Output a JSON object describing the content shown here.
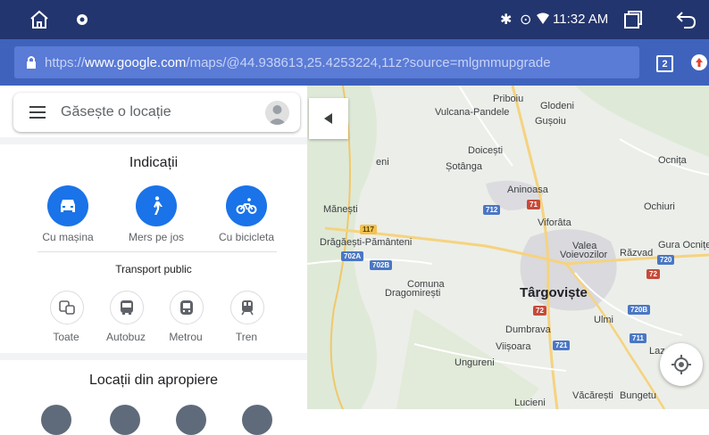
{
  "status_bar": {
    "time": "11:32 AM",
    "icons": [
      "home-icon",
      "settings-icon",
      "bluetooth-icon",
      "location-icon",
      "wifi-icon",
      "recents-icon",
      "back-icon"
    ]
  },
  "browser": {
    "url_prefix": "https://",
    "url_host": "www.google.com",
    "url_path": "/maps/@44.938613,25.4253224,11z?source=mlgmmupgrade",
    "tab_count": "2"
  },
  "sidebar": {
    "search_placeholder": "Găsește o locație",
    "directions_title": "Indicații",
    "directions": [
      {
        "label": "Cu mașina",
        "icon": "car-icon"
      },
      {
        "label": "Mers pe jos",
        "icon": "walk-icon"
      },
      {
        "label": "Cu bicicleta",
        "icon": "bike-icon"
      }
    ],
    "transit_title": "Transport public",
    "transit": [
      {
        "label": "Toate",
        "icon": "all-transit-icon"
      },
      {
        "label": "Autobuz",
        "icon": "bus-icon"
      },
      {
        "label": "Metrou",
        "icon": "subway-icon"
      },
      {
        "label": "Tren",
        "icon": "train-icon"
      }
    ],
    "nearby_title": "Locații din apropiere"
  },
  "map": {
    "places": [
      "Priboiu",
      "Glodeni",
      "Vulcana-Pandele",
      "Gușoiu",
      "Doicești",
      "Șotânga",
      "Ocnița",
      "eni",
      "Aninoasa",
      "Mănești",
      "Viforâta",
      "Ochiuri",
      "Drăgăești-Pământeni",
      "Valea",
      "Voievozilor",
      "Răzvad",
      "Gura Ocniței",
      "Comuna",
      "Dragomirești",
      "Târgoviște",
      "Ulmi",
      "Dumbrava",
      "Viișoara",
      "Ungureni",
      "Laz",
      "Văcărești",
      "Bungetu",
      "Lucieni"
    ],
    "road_shields": [
      "712",
      "71",
      "117",
      "702A",
      "702B",
      "720",
      "72",
      "72",
      "720B",
      "721",
      "711"
    ]
  }
}
